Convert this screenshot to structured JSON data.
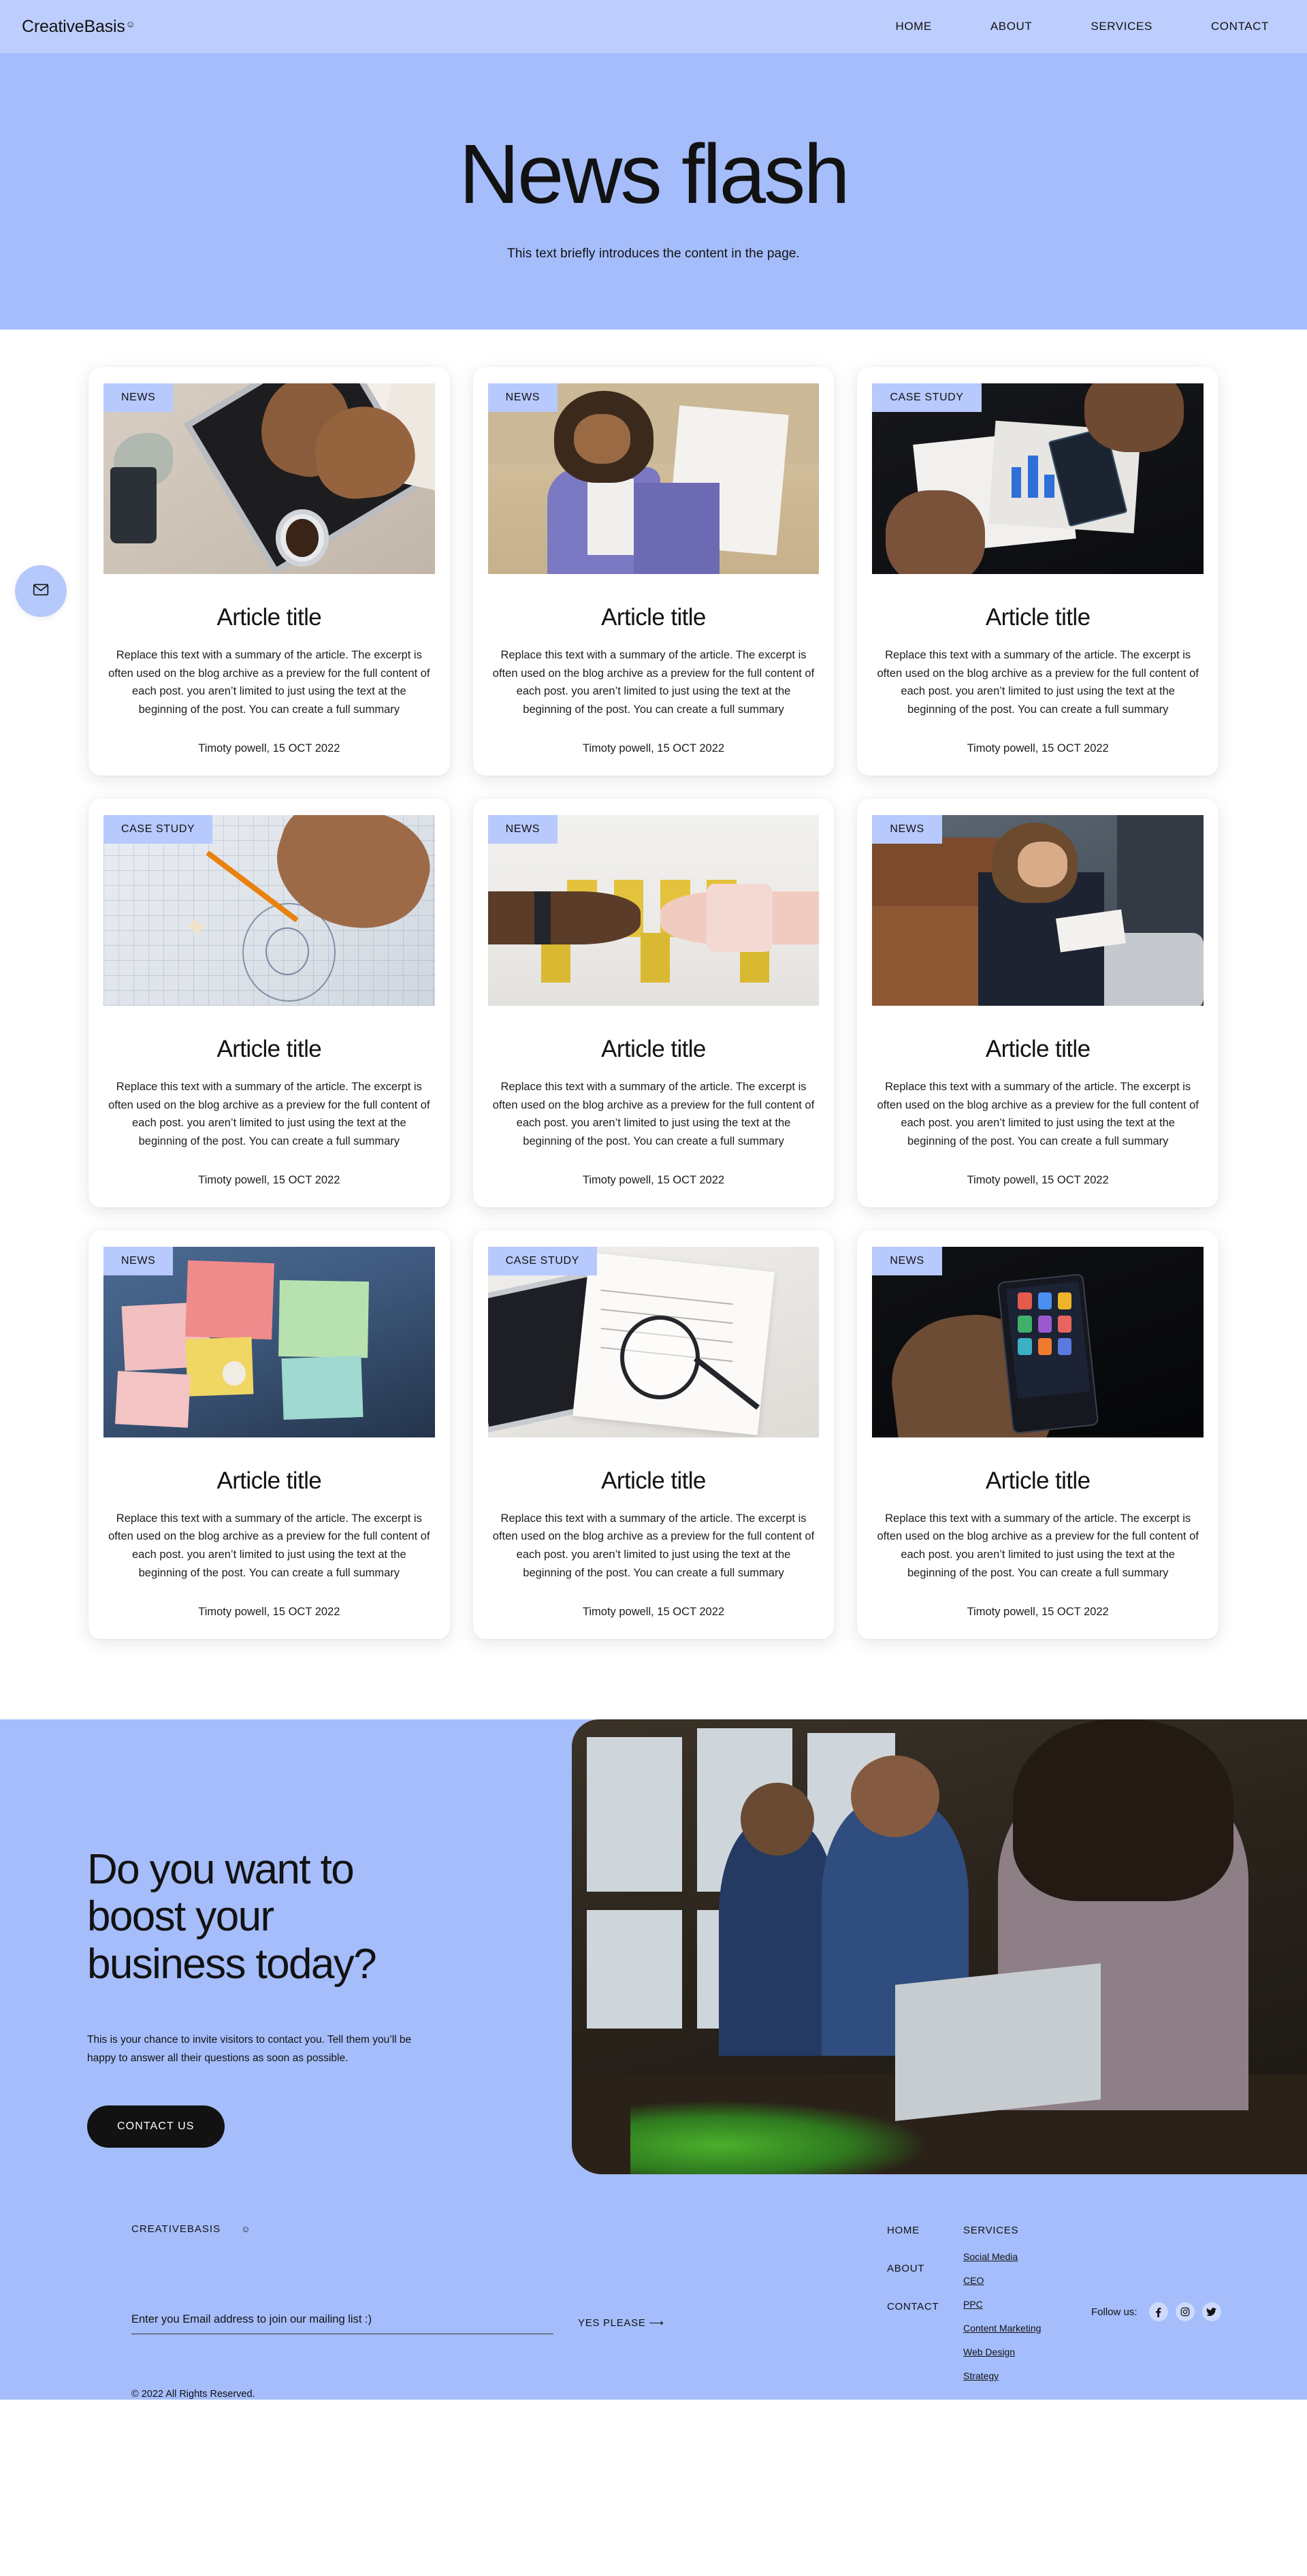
{
  "meta": {
    "accent_blue": "#a5bdfb",
    "nav_blue": "#bdcdfd",
    "badge_blue": "#b7c9fd",
    "dark": "#121212"
  },
  "nav": {
    "brand": "CreativeBasis",
    "brand_mark": "☺",
    "links": [
      {
        "label": "HOME"
      },
      {
        "label": "ABOUT"
      },
      {
        "label": "SERVICES"
      },
      {
        "label": "CONTACT"
      }
    ]
  },
  "hero": {
    "title": "News flash",
    "subtitle": "This text briefly introduces the content in the page."
  },
  "floating": {
    "mail_icon": "mail-icon"
  },
  "cards": [
    {
      "badge": "NEWS",
      "title": "Article title",
      "excerpt": "Replace this text with a summary of the article. The excerpt is often used on the blog archive as a preview for the full content of each post. you aren’t limited to just using the text at the beginning of the post. You can create a full summary",
      "meta": "Timoty powell, 15 OCT 2022",
      "image": "laptop-typing-on-desk"
    },
    {
      "badge": "NEWS",
      "title": "Article title",
      "excerpt": "Replace this text with a summary of the article. The excerpt is often used on the blog archive as a preview for the full content of each post. you aren’t limited to just using the text at the beginning of the post. You can create a full summary",
      "meta": "Timoty powell, 15 OCT 2022",
      "image": "woman-holding-folder"
    },
    {
      "badge": "CASE STUDY",
      "title": "Article title",
      "excerpt": "Replace this text with a summary of the article. The excerpt is often used on the blog archive as a preview for the full content of each post. you aren’t limited to just using the text at the beginning of the post. You can create a full summary",
      "meta": "Timoty powell, 15 OCT 2022",
      "image": "charts-and-phone-on-dark-desk"
    },
    {
      "badge": "CASE STUDY",
      "title": "Article title",
      "excerpt": "Replace this text with a summary of the article. The excerpt is often used on the blog archive as a preview for the full content of each post. you aren’t limited to just using the text at the beginning of the post. You can create a full summary",
      "meta": "Timoty powell, 15 OCT 2022",
      "image": "blueprint-with-pencil"
    },
    {
      "badge": "NEWS",
      "title": "Article title",
      "excerpt": "Replace this text with a summary of the article. The excerpt is often used on the blog archive as a preview for the full content of each post. you aren’t limited to just using the text at the beginning of the post. You can create a full summary",
      "meta": "Timoty powell, 15 OCT 2022",
      "image": "handshake-with-sticky-notes"
    },
    {
      "badge": "NEWS",
      "title": "Article title",
      "excerpt": "Replace this text with a summary of the article. The excerpt is often used on the blog archive as a preview for the full content of each post. you aren’t limited to just using the text at the beginning of the post. You can create a full summary",
      "meta": "Timoty powell, 15 OCT 2022",
      "image": "woman-writing-on-sofa"
    },
    {
      "badge": "NEWS",
      "title": "Article title",
      "excerpt": "Replace this text with a summary of the article. The excerpt is often used on the blog archive as a preview for the full content of each post. you aren’t limited to just using the text at the beginning of the post. You can create a full summary",
      "meta": "Timoty powell, 15 OCT 2022",
      "image": "sticky-notes-board"
    },
    {
      "badge": "CASE STUDY",
      "title": "Article title",
      "excerpt": "Replace this text with a summary of the article. The excerpt is often used on the blog archive as a preview for the full content of each post. you aren’t limited to just using the text at the beginning of the post. You can create a full summary",
      "meta": "Timoty powell, 15 OCT 2022",
      "image": "clipboard-magnifier-laptop"
    },
    {
      "badge": "NEWS",
      "title": "Article title",
      "excerpt": "Replace this text with a summary of the article. The excerpt is often used on the blog archive as a preview for the full content of each post. you aren’t limited to just using the text at the beginning of the post. You can create a full summary",
      "meta": "Timoty powell, 15 OCT 2022",
      "image": "hand-holding-smartphone"
    }
  ],
  "cta": {
    "heading": "Do you want to boost your business today?",
    "body": "This is your chance to invite visitors to contact you. Tell them you’ll be happy to answer all their questions as soon as possible.",
    "button": "CONTACT US",
    "image": "team-working-at-office-desks"
  },
  "footer": {
    "brand": "CREATIVEBASIS",
    "brand_mark": "☺",
    "newsletter": {
      "placeholder": "Enter you Email address to join our mailing list :)",
      "value": "",
      "submit": "YES PLEASE ⟶"
    },
    "copyright": "© 2022 All Rights Reserved.",
    "nav_links": [
      {
        "label": "HOME"
      },
      {
        "label": "ABOUT"
      },
      {
        "label": "CONTACT"
      }
    ],
    "services": {
      "heading": "SERVICES",
      "links": [
        {
          "label": "Social Media"
        },
        {
          "label": "CEO"
        },
        {
          "label": "PPC"
        },
        {
          "label": "Content Marketing"
        },
        {
          "label": "Web Design"
        },
        {
          "label": "Strategy"
        }
      ]
    },
    "follow": {
      "label": "Follow us:",
      "socials": [
        {
          "name": "facebook-icon",
          "glyph": "f"
        },
        {
          "name": "instagram-icon",
          "glyph": "◉"
        },
        {
          "name": "twitter-icon",
          "glyph": "🐦"
        }
      ]
    }
  }
}
